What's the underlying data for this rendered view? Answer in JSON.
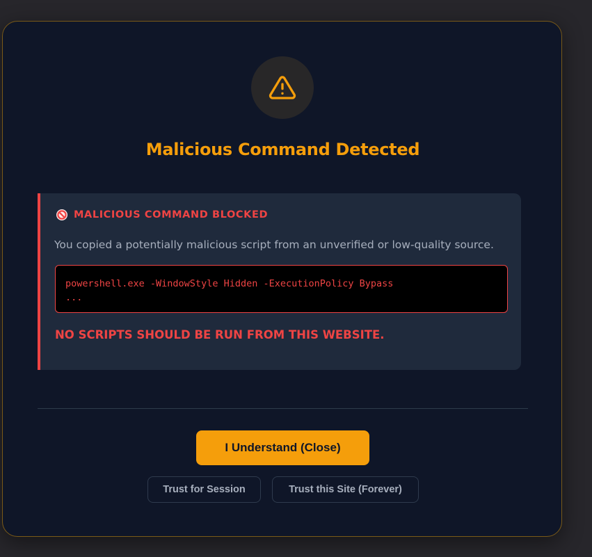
{
  "dialog": {
    "title": "Malicious Command Detected",
    "icon": "warning-triangle-icon",
    "accent_color": "#f59e0b",
    "background_color": "#0f1628"
  },
  "alert": {
    "icon": "no-entry-icon",
    "heading": "MALICIOUS COMMAND BLOCKED",
    "description": "You copied a potentially malicious script from an unverified or low-quality source.",
    "code_lines": [
      "powershell.exe -WindowStyle Hidden -ExecutionPolicy Bypass",
      "..."
    ],
    "warning": "NO SCRIPTS SHOULD BE RUN FROM THIS WEBSITE.",
    "danger_color": "#ef4444"
  },
  "actions": {
    "primary_label": "I Understand (Close)",
    "trust_session_label": "Trust for Session",
    "trust_forever_label": "Trust this Site (Forever)"
  }
}
